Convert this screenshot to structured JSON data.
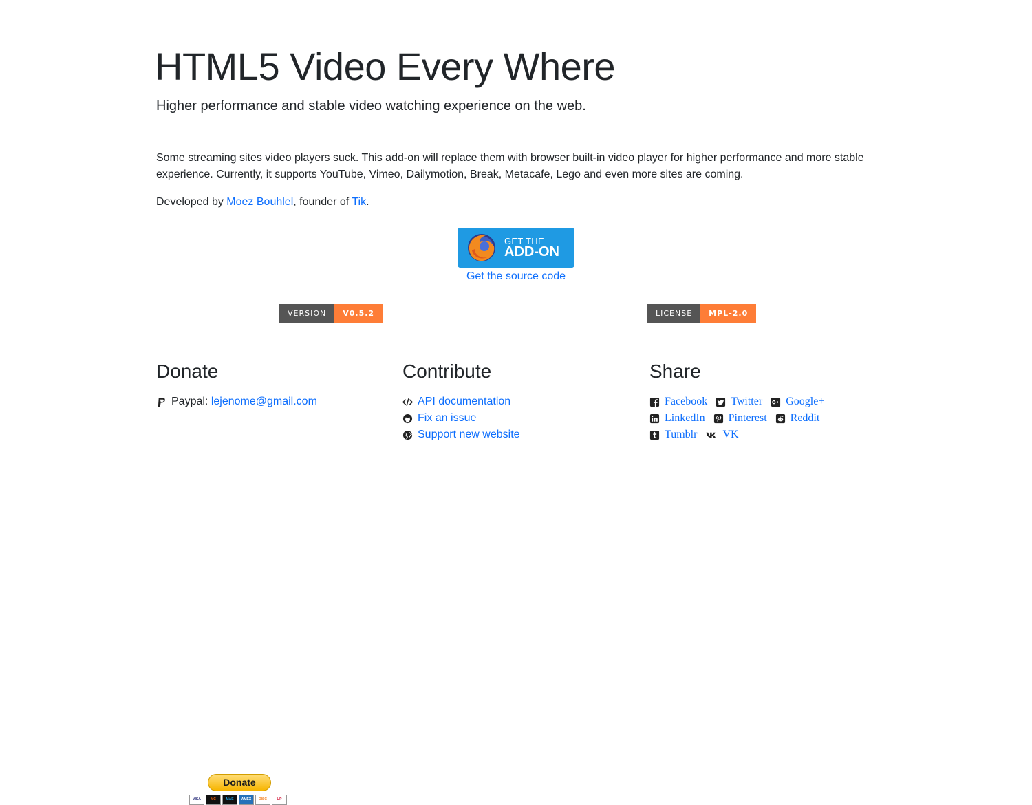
{
  "header": {
    "title": "HTML5 Video Every Where",
    "subtitle": "Higher performance and stable video watching experience on the web."
  },
  "intro": "Some streaming sites video players suck. This add-on will replace them with browser built-in video player for higher performance and more stable experience. Currently, it supports YouTube, Vimeo, Dailymotion, Break, Metacafe, Lego and even more sites are coming.",
  "credit": {
    "prefix": "Developed by ",
    "author": "Moez Bouhlel",
    "middle": ", founder of ",
    "org": "Tik",
    "suffix": "."
  },
  "addon_button": {
    "small": "GET THE",
    "big": "ADD-ON"
  },
  "source_link": "Get the source code",
  "badges": {
    "version": {
      "label": "VERSION",
      "value": "V0.5.2"
    },
    "license": {
      "label": "LICENSE",
      "value": "MPL-2.0"
    }
  },
  "donate": {
    "heading": "Donate",
    "paypal_label": "Paypal: ",
    "paypal_email": "lejenome@gmail.com",
    "button_label": "Donate",
    "cards": [
      "VISA",
      "MC",
      "MAE",
      "AMEX",
      "DISC",
      "UP"
    ]
  },
  "contribute": {
    "heading": "Contribute",
    "items": [
      {
        "label": "API documentation",
        "icon": "code-icon"
      },
      {
        "label": "Fix an issue",
        "icon": "github-icon"
      },
      {
        "label": "Support new website",
        "icon": "globe-icon"
      }
    ]
  },
  "share": {
    "heading": "Share",
    "items": [
      {
        "label": "Facebook",
        "icon": "facebook-icon"
      },
      {
        "label": "Twitter",
        "icon": "twitter-icon"
      },
      {
        "label": "Google+",
        "icon": "google-plus-icon"
      },
      {
        "label": "LinkedIn",
        "icon": "linkedin-icon"
      },
      {
        "label": "Pinterest",
        "icon": "pinterest-icon"
      },
      {
        "label": "Reddit",
        "icon": "reddit-icon"
      },
      {
        "label": "Tumblr",
        "icon": "tumblr-icon"
      },
      {
        "label": "VK",
        "icon": "vk-icon"
      }
    ]
  },
  "colors": {
    "link": "#0d6efd",
    "addon_button": "#1f9ae3",
    "badge_label": "#555555",
    "badge_value": "#fe7d37",
    "donate_button": "#f7b500"
  }
}
